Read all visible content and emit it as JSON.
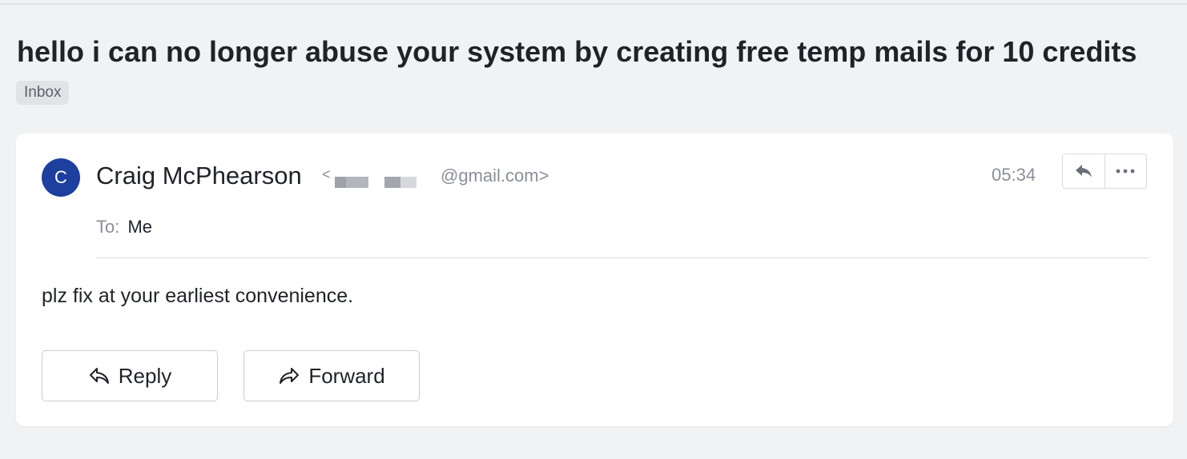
{
  "email": {
    "subject": "hello i can no longer abuse your system by creating free temp mails for 10 credits",
    "folder_badge": "Inbox",
    "sender": {
      "avatar_initial": "C",
      "avatar_color": "#1d3f9e",
      "name": "Craig McPhearson",
      "address_open": "<",
      "address_visible_domain": "@gmail.com>"
    },
    "timestamp": "05:34",
    "header_actions": [
      {
        "icon": "reply-icon"
      },
      {
        "icon": "more-icon"
      }
    ],
    "recipient": {
      "label": "To:",
      "value": "Me"
    },
    "body": "plz fix at your earliest convenience.",
    "footer_actions": {
      "reply_label": "Reply",
      "reply_icon": "reply-outline-icon",
      "forward_label": "Forward",
      "forward_icon": "forward-outline-icon"
    }
  }
}
